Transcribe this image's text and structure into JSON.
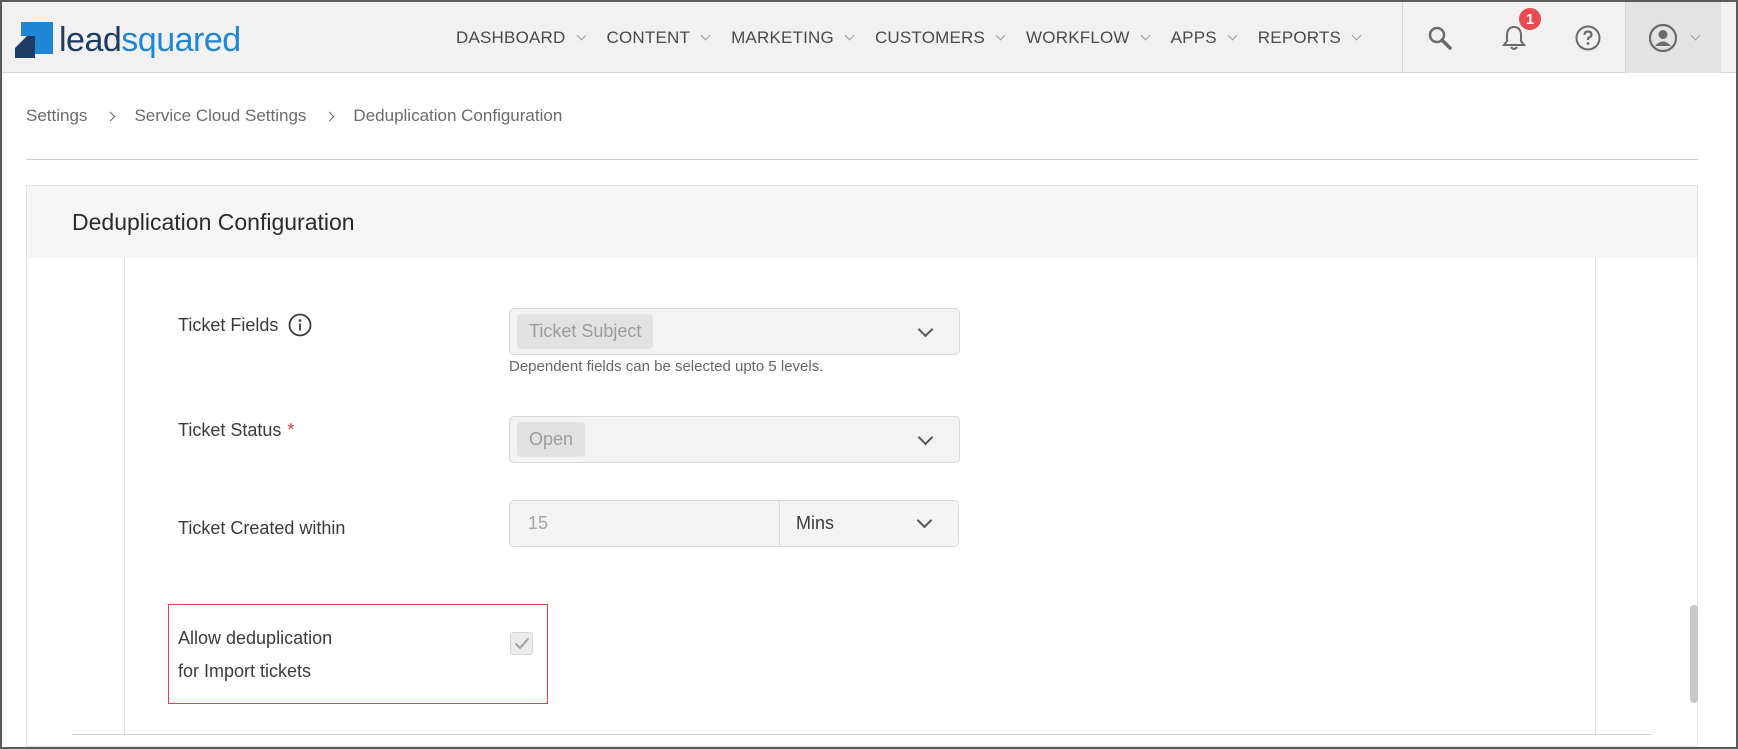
{
  "brand": {
    "logo_lead": "lead",
    "logo_squared": "squared",
    "accent": "#1f87d6",
    "dark": "#1c3c63"
  },
  "nav": {
    "items": [
      {
        "label": "DASHBOARD"
      },
      {
        "label": "CONTENT"
      },
      {
        "label": "MARKETING"
      },
      {
        "label": "CUSTOMERS"
      },
      {
        "label": "WORKFLOW"
      },
      {
        "label": "APPS"
      },
      {
        "label": "REPORTS"
      }
    ],
    "notification_count": "1",
    "icons": [
      "search-icon",
      "bell-icon",
      "help-icon",
      "user-icon"
    ]
  },
  "breadcrumb": {
    "items": [
      {
        "label": "Settings"
      },
      {
        "label": "Service Cloud Settings"
      },
      {
        "label": "Deduplication Configuration"
      }
    ]
  },
  "panel": {
    "title": "Deduplication Configuration",
    "ticket_fields": {
      "label": "Ticket Fields",
      "value": "Ticket Subject",
      "helper": "Dependent fields can be selected upto 5 levels."
    },
    "ticket_status": {
      "label": "Ticket Status",
      "required_mark": "*",
      "value": "Open"
    },
    "ticket_created": {
      "label": "Ticket Created within",
      "value": "15",
      "unit": "Mins"
    },
    "allow_dedup": {
      "label_line1": "Allow deduplication",
      "label_line2": "for Import tickets",
      "checked": true
    }
  },
  "colors": {
    "highlight": "#e0444a",
    "required": "#e03c3c",
    "badge": "#e84a4f"
  }
}
